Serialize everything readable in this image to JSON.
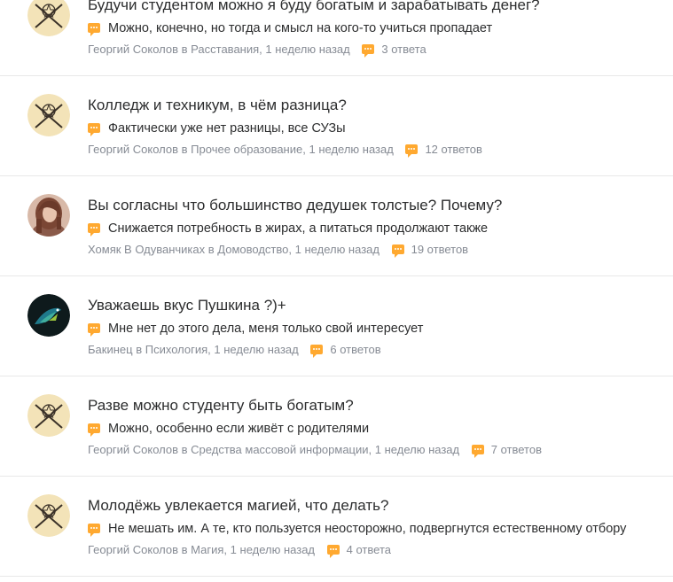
{
  "questions": [
    {
      "title": "Будучи студентом можно я буду богатым и зарабатывать денег?",
      "answer": "Можно, конечно, но тогда и смысл на кого-то учиться пропадает",
      "author": "Георгий Соколов",
      "category_prefix": "в",
      "category": "Расставания",
      "time": "1 неделю назад",
      "answers_count": "3 ответа",
      "avatar": "pentagram-icon"
    },
    {
      "title": "Колледж и техникум, в чём разница?",
      "answer": "Фактически уже нет разницы, все СУЗы",
      "author": "Георгий Соколов",
      "category_prefix": "в",
      "category": "Прочее образование",
      "time": "1 неделю назад",
      "answers_count": "12 ответов",
      "avatar": "pentagram-icon"
    },
    {
      "title": "Вы согласны что большинство дедушек толстые? Почему?",
      "answer": "Снижается потребность в жирах, а питаться продолжают также",
      "author": "Хомяк В Одуванчиках",
      "category_prefix": "в",
      "category": "Домоводство",
      "time": "1 неделю назад",
      "answers_count": "19 ответов",
      "avatar": "photo-girl"
    },
    {
      "title": "Уважаешь вкус Пушкина ?)+",
      "answer": "Мне нет до этого дела, меня только свой интересует",
      "author": "Бакинец",
      "category_prefix": "в",
      "category": "Психология",
      "time": "1 неделю назад",
      "answers_count": "6 ответов",
      "avatar": "bird-photo"
    },
    {
      "title": "Разве можно студенту быть богатым?",
      "answer": "Можно, особенно если живёт с родителями",
      "author": "Георгий Соколов",
      "category_prefix": "в",
      "category": "Средства массовой информации",
      "time": "1 неделю назад",
      "answers_count": "7 ответов",
      "avatar": "pentagram-icon"
    },
    {
      "title": "Молодёжь увлекается магией, что делать?",
      "answer": "Не мешать им. А те, кто пользуется неосторожно, подвергнутся естественному отбору",
      "author": "Георгий Соколов",
      "category_prefix": "в",
      "category": "Магия",
      "time": "1 неделю назад",
      "answers_count": "4 ответа",
      "avatar": "pentagram-icon"
    }
  ],
  "colors": {
    "accent": "#ffa930",
    "meta": "#868b94",
    "text": "#2c2d2e",
    "divider": "#e8e8e8"
  }
}
